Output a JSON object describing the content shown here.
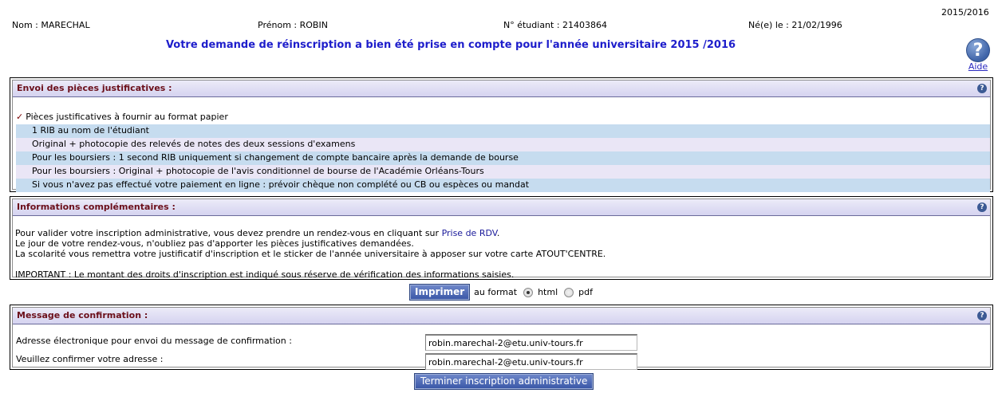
{
  "header": {
    "year": "2015/2016",
    "nom": "Nom : MARECHAL",
    "prenom": "Prénom : ROBIN",
    "etudiant": "N° étudiant : 21403864",
    "naissance": "Né(e) le : 21/02/1996",
    "confirmation": "Votre demande de réinscription a bien été prise en compte pour l'année universitaire 2015 /2016"
  },
  "help": {
    "icon": "?",
    "label": "Aide"
  },
  "pieces": {
    "title": "Envoi des pièces justificatives :",
    "subtitle": "Pièces justificatives à fournir au format papier",
    "items": [
      "1 RIB au nom de l'étudiant",
      "Original + photocopie des relevés de notes des deux sessions d'examens",
      "Pour les boursiers : 1 second RIB uniquement si changement de compte bancaire après la demande de bourse",
      "Pour les boursiers : Original + photocopie de l'avis conditionnel de bourse de l'Académie Orléans-Tours",
      "Si vous n'avez pas effectué votre paiement en ligne : prévoir chèque non complété ou CB ou espèces ou mandat"
    ]
  },
  "infos": {
    "title": "Informations complémentaires :",
    "line1_pre": "Pour valider votre inscription administrative, vous devez prendre un rendez-vous en cliquant sur ",
    "line1_link": "Prise de RDV",
    "line1_post": ".",
    "line2": "Le jour de votre rendez-vous, n'oubliez pas d'apporter les pièces justificatives demandées.",
    "line3": "La scolarité vous remettra votre justificatif d'inscription et le sticker de l'année universitaire à apposer sur votre carte ATOUT'CENTRE.",
    "important": "IMPORTANT : Le montant des droits d'inscription est indiqué sous réserve de vérification des informations saisies."
  },
  "print": {
    "button": "Imprimer",
    "format_label": "au format",
    "options": [
      "html",
      "pdf"
    ],
    "selected": "html"
  },
  "message": {
    "title": "Message de confirmation :",
    "email_label": "Adresse électronique pour envoi du message de confirmation :",
    "email_value": "robin.marechal-2@etu.univ-tours.fr",
    "confirm_label": "Veuillez confirmer votre adresse :",
    "confirm_value": "robin.marechal-2@etu.univ-tours.fr"
  },
  "finish_button": "Terminer inscription administrative",
  "colors": {
    "title_blue": "#1d1dcb",
    "section_title": "#6b0f1a",
    "row_blue": "#c6dcef",
    "row_lavender": "#eae6f6",
    "button": "#3b58a8"
  }
}
